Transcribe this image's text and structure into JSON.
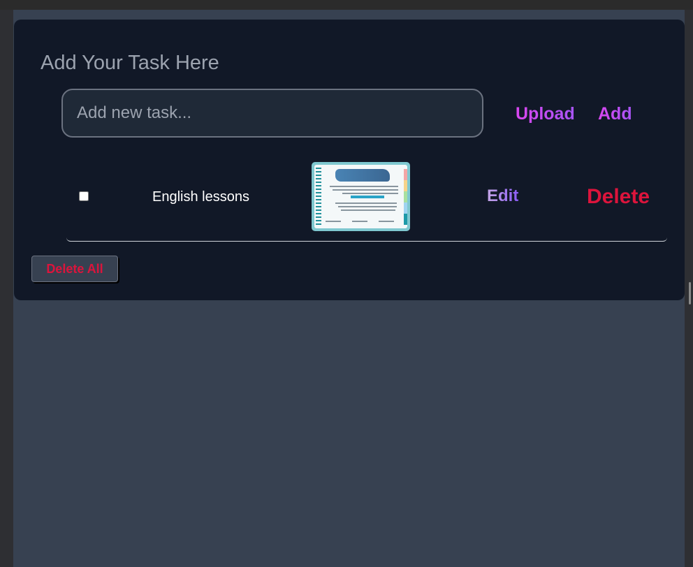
{
  "header": {
    "title": "Add Your Task Here"
  },
  "input": {
    "placeholder": "Add new task...",
    "value": ""
  },
  "actions": {
    "upload_label": "Upload",
    "add_label": "Add"
  },
  "tasks": [
    {
      "text": "English lessons",
      "checked": false,
      "has_image": true,
      "edit_label": "Edit",
      "delete_label": "Delete"
    }
  ],
  "footer": {
    "delete_all_label": "Delete All"
  },
  "colors": {
    "page_bg": "#374151",
    "card_bg": "#111827",
    "input_bg": "#1f2937",
    "accent_gradient_start": "#d946ef",
    "accent_gradient_end": "#a855f7",
    "danger": "#dc143c",
    "heading": "#9ca3af"
  }
}
